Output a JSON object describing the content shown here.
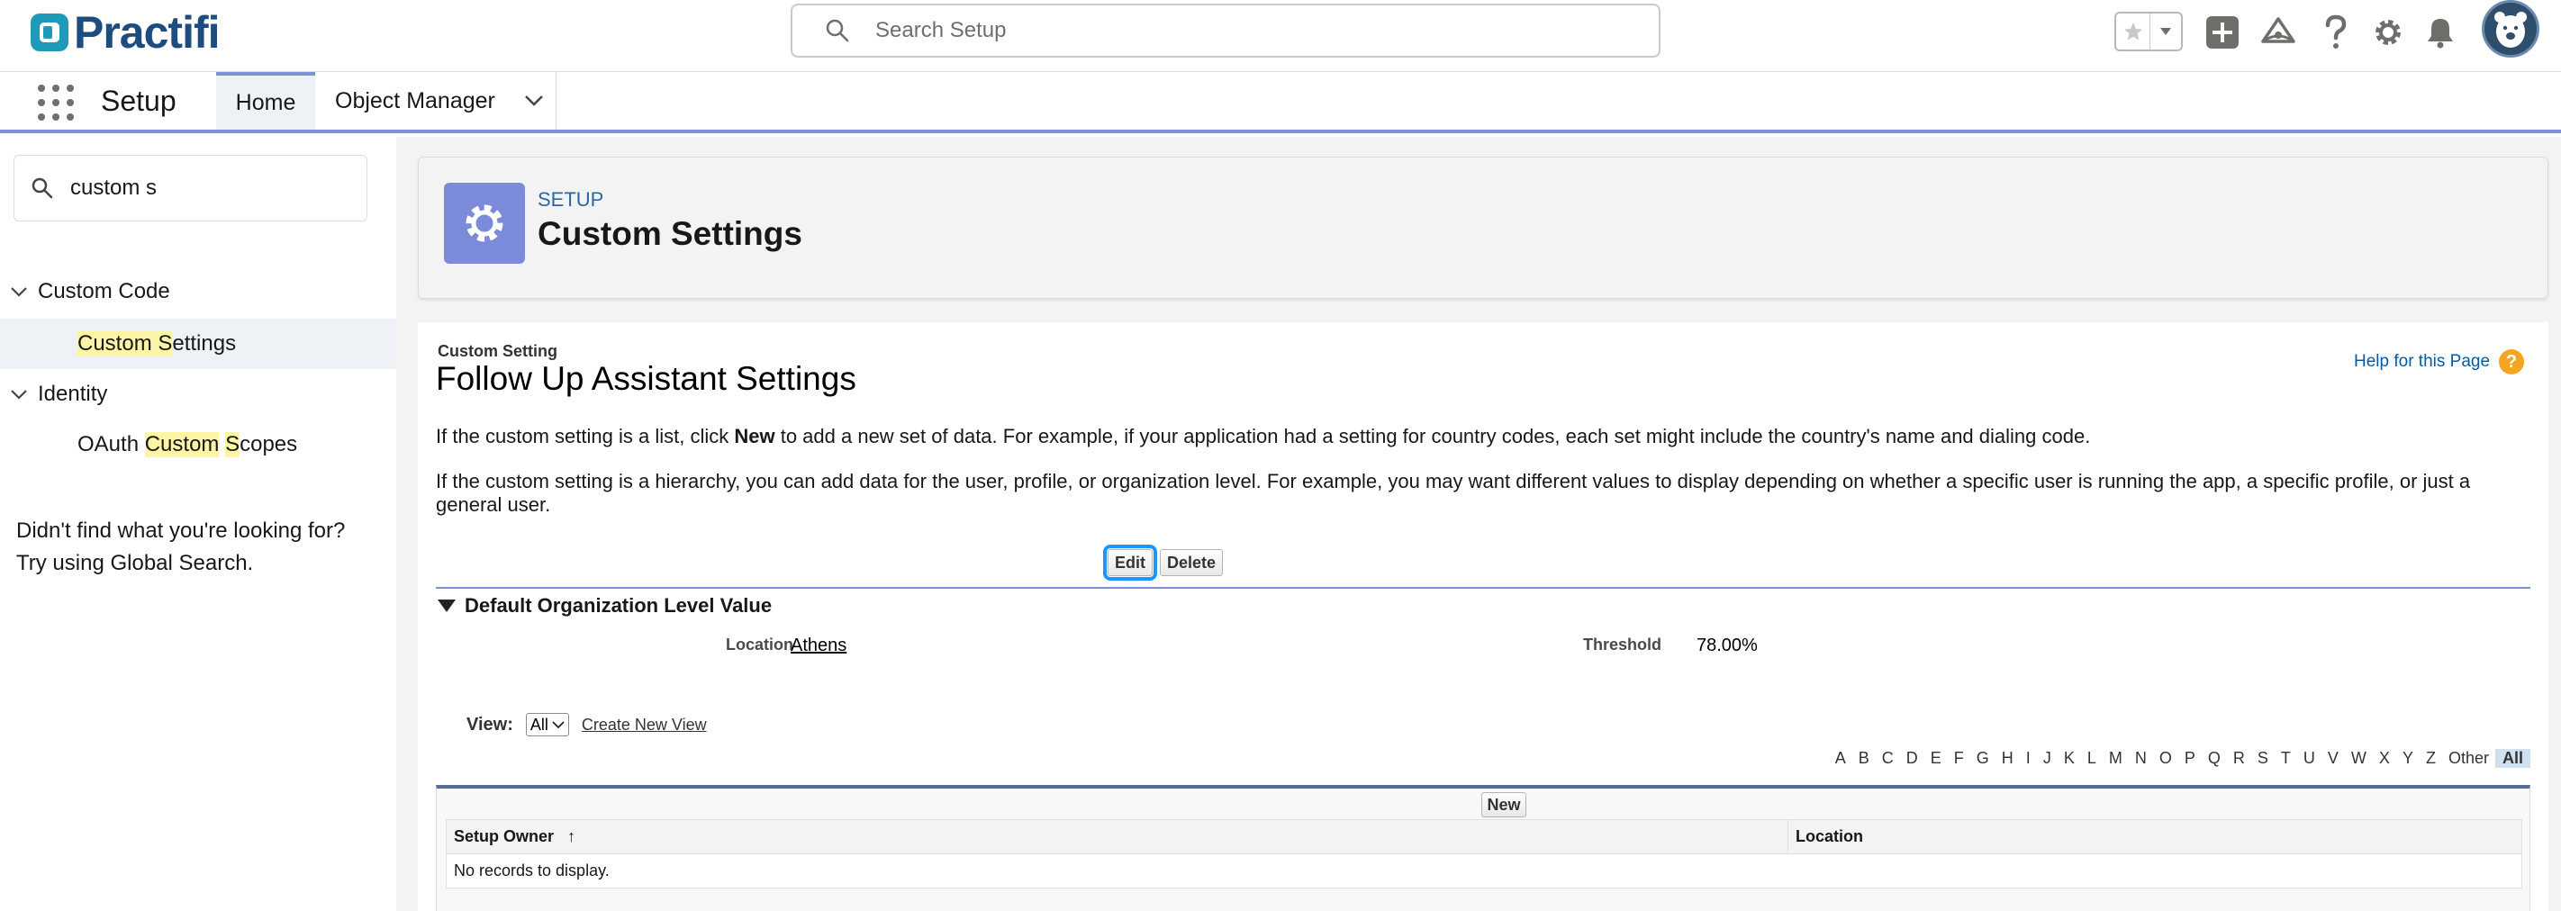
{
  "header": {
    "logo_text": "Practifi",
    "search_placeholder": "Search Setup"
  },
  "nav": {
    "app_name": "Setup",
    "tabs": [
      {
        "label": "Home"
      },
      {
        "label": "Object Manager"
      }
    ]
  },
  "sidebar": {
    "quick_find_value": "custom s",
    "tree": [
      {
        "label": "Custom Code",
        "children": [
          {
            "label_pre": "Custom S",
            "label_post": "ettings"
          }
        ]
      },
      {
        "label": "Identity",
        "children": [
          {
            "label_a": "OAuth ",
            "label_hl1": "Custom",
            "label_mid": " ",
            "label_hl2": "S",
            "label_post": "copes"
          }
        ]
      }
    ],
    "not_found_line1": "Didn't find what you're looking for?",
    "not_found_line2": "Try using Global Search."
  },
  "page_header": {
    "eyebrow": "SETUP",
    "title": "Custom Settings"
  },
  "detail": {
    "type_label": "Custom Setting",
    "title": "Follow Up Assistant Settings",
    "help_link": "Help for this Page",
    "para1_pre": "If the custom setting is a list, click ",
    "para1_bold": "New",
    "para1_post": " to add a new set of data. For example, if your application had a setting for country codes, each set might include the country's name and dialing code.",
    "para2_line1": "If the custom setting is a hierarchy, you can add data for the user, profile, or organization level. For example, you may want different values to display depending on whether a specific user is running the app, a specific profile, or just a",
    "para2_line2": "general user.",
    "edit_label": "Edit",
    "delete_label": "Delete",
    "section_title": "Default Organization Level Value",
    "fields": [
      {
        "label": "Location",
        "value": "Athens"
      },
      {
        "label": "Threshold",
        "value": "78.00%"
      }
    ],
    "view_label": "View:",
    "view_selected": "All",
    "create_view_link": "Create New View",
    "alphabet": [
      "A",
      "B",
      "C",
      "D",
      "E",
      "F",
      "G",
      "H",
      "I",
      "J",
      "K",
      "L",
      "M",
      "N",
      "O",
      "P",
      "Q",
      "R",
      "S",
      "T",
      "U",
      "V",
      "W",
      "X",
      "Y",
      "Z",
      "Other",
      "All"
    ],
    "new_label": "New",
    "columns": [
      "Setup Owner",
      "Location"
    ],
    "sort_indicator": "↑",
    "empty_message": "No records to display."
  },
  "colors": {
    "accent": "#7d91d6",
    "brand": "#1d4d7e",
    "link": "#015ba7",
    "highlight": "#fcf5a5",
    "focus": "#1b96ff"
  }
}
